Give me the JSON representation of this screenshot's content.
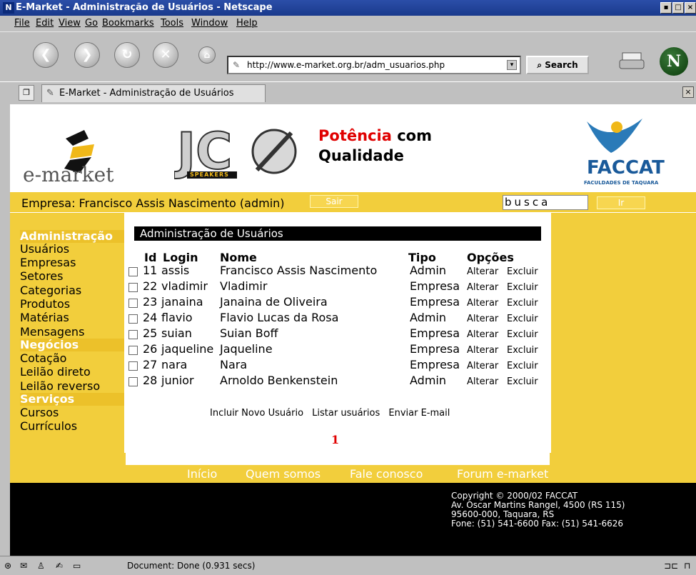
{
  "window": {
    "title": "E-Market - Administração de Usuários - Netscape"
  },
  "menu": [
    "File",
    "Edit",
    "View",
    "Go",
    "Bookmarks",
    "Tools",
    "Window",
    "Help"
  ],
  "nav": {
    "url": "http://www.e-market.org.br/adm_usuarios.php",
    "search_label": "Search",
    "browser_logo": "N"
  },
  "tab": {
    "title": "E-Market - Administração de Usuários"
  },
  "header": {
    "logo_text": "e-market",
    "logo2_sub": "SPEAKERS",
    "slogan_red": "Potência",
    "slogan_rest1": "com",
    "slogan_rest2": "Qualidade",
    "faccat_name": "FACCAT",
    "faccat_sub": "FACULDADES DE TAQUARA"
  },
  "userbar": {
    "empresa": "Empresa: Francisco Assis Nascimento (admin)",
    "sair": "Sair",
    "busca": "busca",
    "ir": "Ir"
  },
  "sidebar": {
    "sec1": "Administração",
    "admin_items": [
      "Usuários",
      "Empresas",
      "Setores",
      "Categorias",
      "Produtos",
      "Matérias",
      "Mensagens"
    ],
    "sec2": "Negócios",
    "neg_items": [
      "Cotação",
      "Leilão direto",
      "Leilão reverso"
    ],
    "sec3": "Serviços",
    "serv_items": [
      "Cursos",
      "Currículos"
    ]
  },
  "content": {
    "title": "Administração de Usuários",
    "headers": {
      "id": "Id",
      "login": "Login",
      "nome": "Nome",
      "tipo": "Tipo",
      "opcoes": "Opções"
    },
    "rows": [
      {
        "id": "11",
        "login": "assis",
        "nome": "Francisco Assis Nascimento",
        "tipo": "Admin",
        "alterar": "Alterar",
        "excluir": "Excluir"
      },
      {
        "id": "22",
        "login": "vladimir",
        "nome": "Vladimir",
        "tipo": "Empresa",
        "alterar": "Alterar",
        "excluir": "Excluir"
      },
      {
        "id": "23",
        "login": "janaina",
        "nome": "Janaina de Oliveira",
        "tipo": "Empresa",
        "alterar": "Alterar",
        "excluir": "Excluir"
      },
      {
        "id": "24",
        "login": "flavio",
        "nome": "Flavio Lucas da Rosa",
        "tipo": "Admin",
        "alterar": "Alterar",
        "excluir": "Excluir"
      },
      {
        "id": "25",
        "login": "suian",
        "nome": "Suian Boff",
        "tipo": "Empresa",
        "alterar": "Alterar",
        "excluir": "Excluir"
      },
      {
        "id": "26",
        "login": "jaqueline",
        "nome": "Jaqueline",
        "tipo": "Empresa",
        "alterar": "Alterar",
        "excluir": "Excluir"
      },
      {
        "id": "27",
        "login": "nara",
        "nome": "Nara",
        "tipo": "Empresa",
        "alterar": "Alterar",
        "excluir": "Excluir"
      },
      {
        "id": "28",
        "login": "junior",
        "nome": "Arnoldo Benkenstein",
        "tipo": "Admin",
        "alterar": "Alterar",
        "excluir": "Excluir"
      }
    ],
    "actions": [
      "Incluir Novo Usuário",
      "Listar usuários",
      "Enviar E-mail"
    ],
    "page": "1"
  },
  "footer_nav": [
    "Início",
    "Quem somos",
    "Fale conosco",
    "Forum e-market"
  ],
  "copyright": [
    "Copyright © 2000/02 FACCAT",
    "Av. Oscar Martins Rangel, 4500 (RS 115)",
    "95600-000, Taquara, RS",
    "Fone: (51) 541-6600 Fax: (51) 541-6626"
  ],
  "status": {
    "text": "Document: Done (0.931 secs)"
  },
  "colors": {
    "yellow": "#f2ce3c",
    "section": "#ecc12a",
    "red": "#e00000",
    "title_blue": "#1a3a8c"
  }
}
